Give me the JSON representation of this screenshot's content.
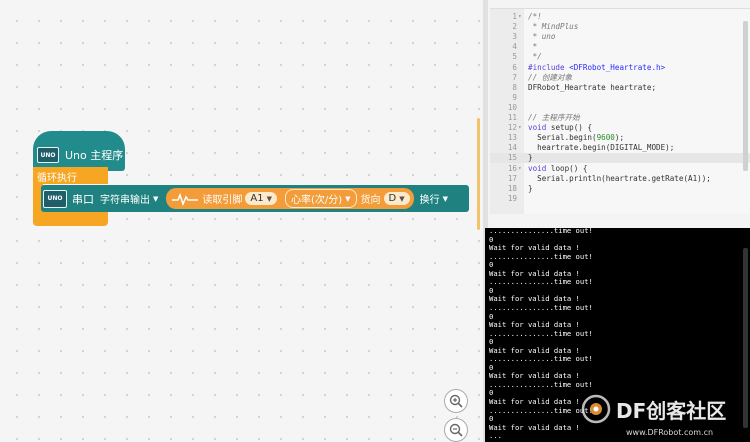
{
  "program": {
    "hat_label": "Uno 主程序",
    "loop_label": "循环执行",
    "board_label": "UNO",
    "serial_block": {
      "port": "串口",
      "mode": "字符串输出",
      "heartrate_label": "读取引脚",
      "pin": "A1",
      "measure": "心率(次/分)",
      "direction_label": "货向",
      "direction_value": "D",
      "newline": "换行"
    }
  },
  "editor": {
    "lines": [
      {
        "n": "1",
        "fold": "▾",
        "html": "<span class=\"cm\">/*!</span>"
      },
      {
        "n": "2",
        "fold": "",
        "html": "<span class=\"cm\"> * MindPlus</span>"
      },
      {
        "n": "3",
        "fold": "",
        "html": "<span class=\"cm\"> * uno</span>"
      },
      {
        "n": "4",
        "fold": "",
        "html": "<span class=\"cm\"> *</span>"
      },
      {
        "n": "5",
        "fold": "",
        "html": "<span class=\"cm\"> */</span>"
      },
      {
        "n": "6",
        "fold": "",
        "html": "<span class=\"kw\">#include</span> <span class=\"pp\">&lt;DFRobot_Heartrate.h&gt;</span>"
      },
      {
        "n": "7",
        "fold": "",
        "html": "<span class=\"cm\">// 创建对象</span>"
      },
      {
        "n": "8",
        "fold": "",
        "html": "DFRobot_Heartrate heartrate;"
      },
      {
        "n": "9",
        "fold": "",
        "html": ""
      },
      {
        "n": "10",
        "fold": "",
        "html": ""
      },
      {
        "n": "11",
        "fold": "",
        "html": "<span class=\"cm\">// 主程序开始</span>"
      },
      {
        "n": "12",
        "fold": "▾",
        "html": "<span class=\"kw\">void</span> setup() {"
      },
      {
        "n": "13",
        "fold": "",
        "html": "  Serial.begin(<span class=\"num\">9600</span>);"
      },
      {
        "n": "14",
        "fold": "",
        "html": "  heartrate.begin(DIGITAL_MODE);"
      },
      {
        "n": "15",
        "fold": "",
        "html": "}"
      },
      {
        "n": "16",
        "fold": "▾",
        "html": "<span class=\"kw\">void</span> loop() {"
      },
      {
        "n": "17",
        "fold": "",
        "html": "  Serial.println(heartrate.getRate(A1));"
      },
      {
        "n": "18",
        "fold": "",
        "html": "}"
      },
      {
        "n": "19",
        "fold": "",
        "html": ""
      }
    ],
    "active_line": "15"
  },
  "monitor": {
    "lines": [
      "...............time out!",
      "0",
      "Wait for valid data !",
      "...............time out!",
      "0",
      "Wait for valid data !",
      "...............time out!",
      "0",
      "Wait for valid data !",
      "...............time out!",
      "0",
      "Wait for valid data !",
      "...............time out!",
      "0",
      "Wait for valid data !",
      "...............time out!",
      "0",
      "Wait for valid data !",
      "...............time out!",
      "0",
      "Wait for valid data !",
      "...............time out!",
      "0",
      "Wait for valid data !",
      "..."
    ]
  },
  "watermark": {
    "brand": "DF创客社区",
    "url": "www.DFRobot.com.cn"
  },
  "icons": {
    "zoom_in": "zoom-in-icon",
    "zoom_out": "zoom-out-icon",
    "heartbeat": "heartbeat-icon"
  },
  "colors": {
    "hat": "#228c8c",
    "loop": "#f6a623",
    "serial": "#208280",
    "heartrate": "#f39c3a"
  }
}
